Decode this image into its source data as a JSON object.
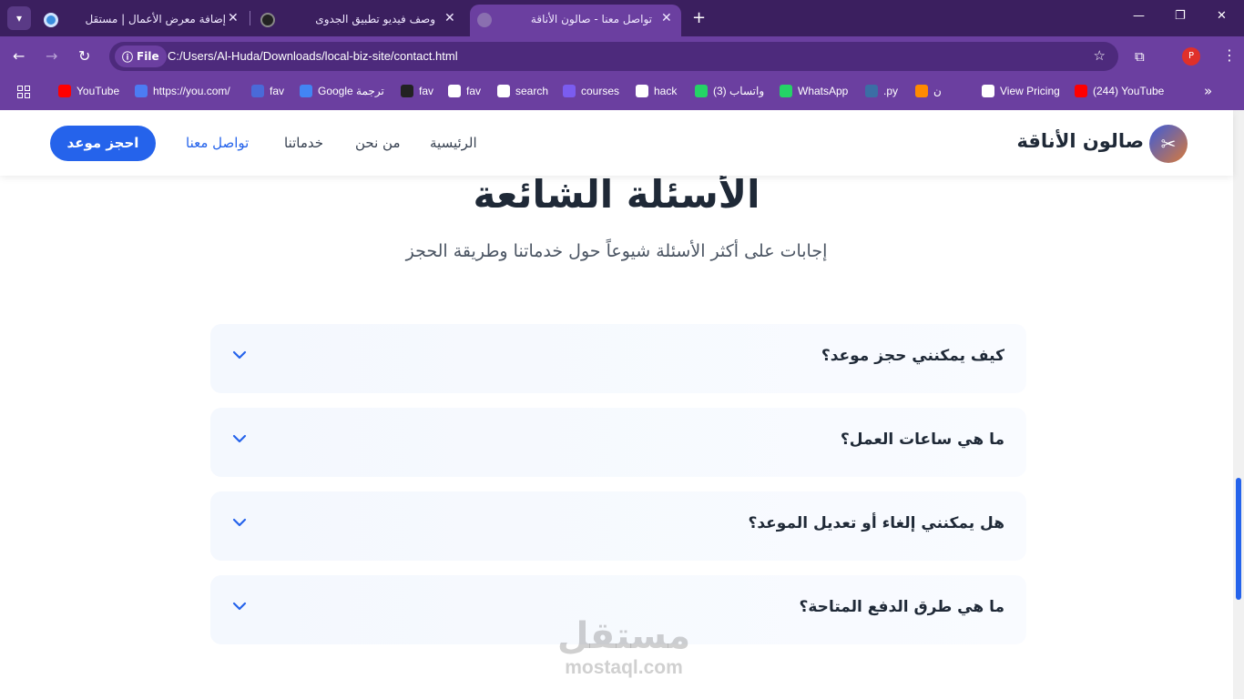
{
  "browser": {
    "tabs": [
      {
        "title": "إضافة معرض الأعمال | مستقل",
        "active": false
      },
      {
        "title": "وصف فيديو تطبيق الجدوى",
        "active": false
      },
      {
        "title": "تواصل معنا - صالون الأناقة",
        "active": true
      }
    ],
    "new_tab": "+",
    "address": {
      "scheme_label": "File",
      "url": "C:/Users/Al-Huda/Downloads/local-biz-site/contact.html"
    },
    "profile_initial": "P",
    "bookmarks": [
      {
        "label": "YouTube",
        "icon": "youtube-icon",
        "color": "#ff0000"
      },
      {
        "label": "https://you.com/",
        "icon": "you-icon",
        "color": "#4c7cf3"
      },
      {
        "label": "fav",
        "icon": "fav-icon",
        "color": "#4a6ad8"
      },
      {
        "label": "Google ترجمة",
        "icon": "translate-icon",
        "color": "#4285f4"
      },
      {
        "label": "fav",
        "icon": "fav-icon",
        "color": "#222222"
      },
      {
        "label": "fav",
        "icon": "ha-icon",
        "color": "#ffffff"
      },
      {
        "label": "search",
        "icon": "search-bm-icon",
        "color": "#ffffff"
      },
      {
        "label": "courses",
        "icon": "udemy-icon",
        "color": "#7b5cf0"
      },
      {
        "label": "hack",
        "icon": "folder-icon",
        "color": "#ffffff"
      },
      {
        "label": "(3) واتساب",
        "icon": "whatsapp-icon",
        "color": "#25d366"
      },
      {
        "label": "WhatsApp",
        "icon": "whatsapp-icon",
        "color": "#25d366"
      },
      {
        "label": ".py",
        "icon": "py-icon",
        "color": "#3b6ea5"
      },
      {
        "label": "ن",
        "icon": "firefox-icon",
        "color": "#ff8a00"
      },
      {
        "label": "View Pricing",
        "icon": "globe-icon",
        "color": "#ffffff"
      },
      {
        "label": "(244) YouTube",
        "icon": "youtube-icon",
        "color": "#ff0000"
      }
    ]
  },
  "site": {
    "logo_text": "صالون الأناقة",
    "nav": [
      {
        "label": "الرئيسية",
        "active": false
      },
      {
        "label": "من نحن",
        "active": false
      },
      {
        "label": "خدماتنا",
        "active": false
      },
      {
        "label": "تواصل معنا",
        "active": true
      }
    ],
    "cta_label": "احجز موعد",
    "accent": "#2563eb"
  },
  "faq": {
    "title": "الأسئلة الشائعة",
    "subtitle": "إجابات على أكثر الأسئلة شيوعاً حول خدماتنا وطريقة الحجز",
    "items": [
      {
        "question": "كيف يمكنني حجز موعد؟"
      },
      {
        "question": "ما هي ساعات العمل؟"
      },
      {
        "question": "هل يمكنني إلغاء أو تعديل الموعد؟"
      },
      {
        "question": "ما هي طرق الدفع المتاحة؟"
      }
    ]
  },
  "watermark": {
    "arabic": "مستقل",
    "latin": "mostaql.com"
  }
}
